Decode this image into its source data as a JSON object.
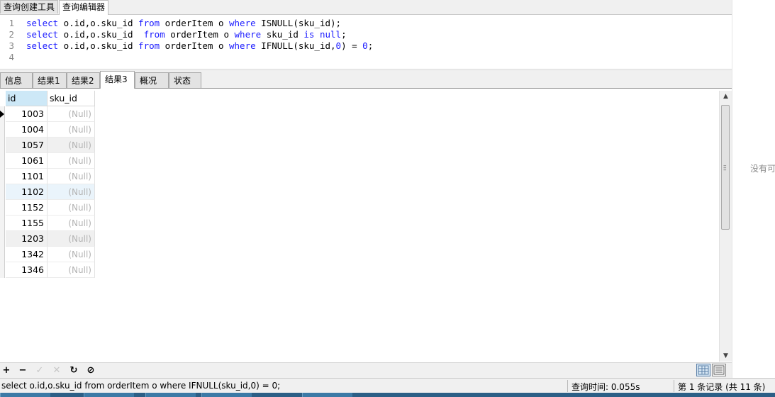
{
  "tabs": [
    "查询创建工具",
    "查询编辑器"
  ],
  "editor": {
    "lines": [
      {
        "num": "1",
        "parts": [
          [
            "kw",
            "select"
          ],
          [
            "tx",
            " o.id,o.sku_id "
          ],
          [
            "kw",
            "from"
          ],
          [
            "tx",
            " orderItem o "
          ],
          [
            "kw",
            "where"
          ],
          [
            "tx",
            " ISNULL(sku_id);"
          ]
        ]
      },
      {
        "num": "2",
        "parts": [
          [
            "kw",
            "select"
          ],
          [
            "tx",
            " o.id,o.sku_id  "
          ],
          [
            "kw",
            "from"
          ],
          [
            "tx",
            " orderItem o "
          ],
          [
            "kw",
            "where"
          ],
          [
            "tx",
            " sku_id "
          ],
          [
            "kw",
            "is"
          ],
          [
            "tx",
            " "
          ],
          [
            "kw",
            "null"
          ],
          [
            "tx",
            ";"
          ]
        ]
      },
      {
        "num": "3",
        "parts": [
          [
            "kw",
            "select"
          ],
          [
            "tx",
            " o.id,o.sku_id "
          ],
          [
            "kw",
            "from"
          ],
          [
            "tx",
            " orderItem o "
          ],
          [
            "kw",
            "where"
          ],
          [
            "tx",
            " IFNULL(sku_id,"
          ],
          [
            "num",
            "0"
          ],
          [
            "tx",
            ") = "
          ],
          [
            "num",
            "0"
          ],
          [
            "tx",
            ";"
          ]
        ]
      },
      {
        "num": "4",
        "parts": []
      }
    ]
  },
  "result_tabs": [
    "信息",
    "结果1",
    "结果2",
    "结果3",
    "概况",
    "状态"
  ],
  "active_result_tab": 3,
  "grid": {
    "columns": [
      "id",
      "sku_id"
    ],
    "rows": [
      {
        "id": "1003",
        "sku_id": "(Null)"
      },
      {
        "id": "1004",
        "sku_id": "(Null)"
      },
      {
        "id": "1057",
        "sku_id": "(Null)"
      },
      {
        "id": "1061",
        "sku_id": "(Null)"
      },
      {
        "id": "1101",
        "sku_id": "(Null)"
      },
      {
        "id": "1102",
        "sku_id": "(Null)"
      },
      {
        "id": "1152",
        "sku_id": "(Null)"
      },
      {
        "id": "1155",
        "sku_id": "(Null)"
      },
      {
        "id": "1203",
        "sku_id": "(Null)"
      },
      {
        "id": "1342",
        "sku_id": "(Null)"
      },
      {
        "id": "1346",
        "sku_id": "(Null)"
      }
    ]
  },
  "toolbar": {
    "add_icon": "+",
    "delete_icon": "−",
    "apply_icon": "✓",
    "cancel_icon": "✕",
    "refresh_icon": "↻",
    "stop_icon": "⊘"
  },
  "status": {
    "sql": "select o.id,o.sku_id from orderItem o where IFNULL(sku_id,0) = 0;",
    "query_time": "查询时间: 0.055s",
    "records": "第 1 条记录 (共 11 条)"
  },
  "side_text": "没有可"
}
